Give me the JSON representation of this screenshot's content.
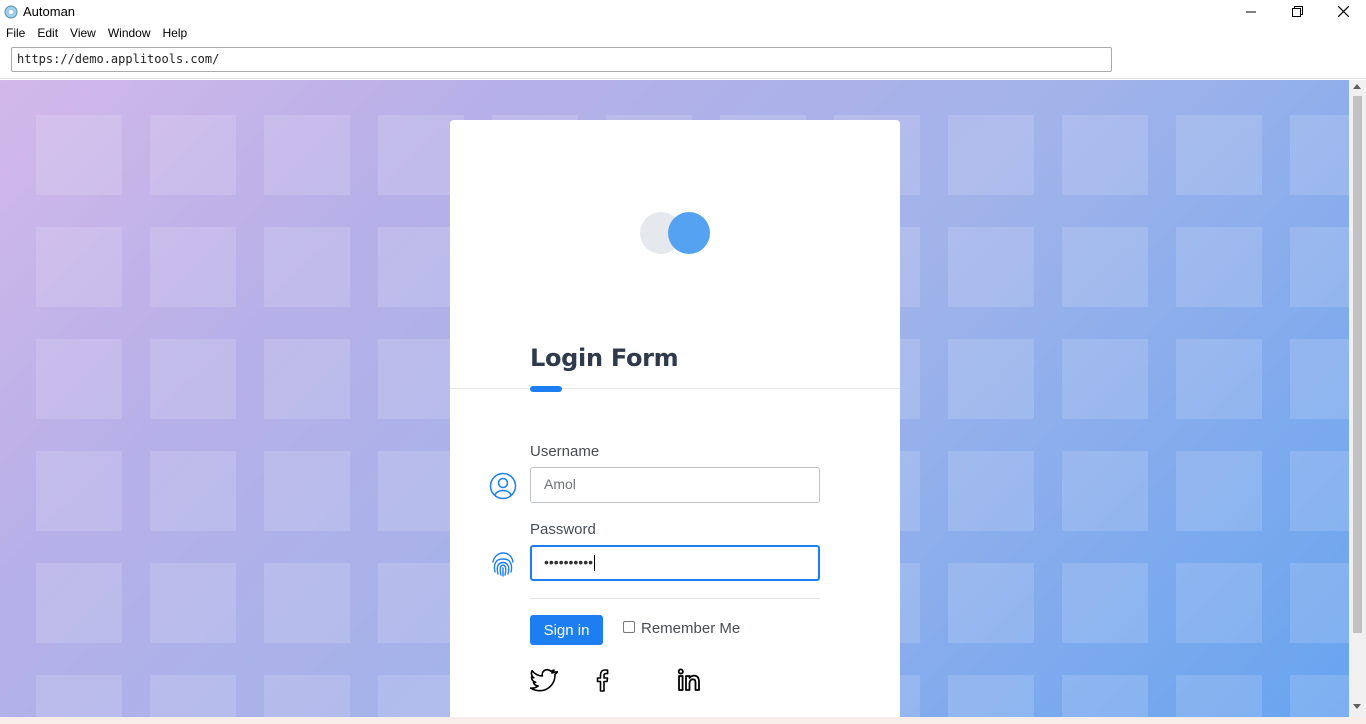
{
  "window": {
    "title": "Automan",
    "controls": {
      "minimize": "minimize-icon",
      "maximize": "restore-icon",
      "close": "close-icon"
    }
  },
  "menu": [
    "File",
    "Edit",
    "View",
    "Window",
    "Help"
  ],
  "address_bar": {
    "url": "https://demo.applitools.com/"
  },
  "login": {
    "title": "Login Form",
    "username_label": "Username",
    "username_placeholder": "Amol",
    "password_label": "Password",
    "password_value": "••••••••••",
    "signin_label": "Sign in",
    "remember_label": "Remember Me",
    "remember_checked": false
  },
  "social_icons": [
    "twitter-icon",
    "facebook-icon",
    "linkedin-icon"
  ],
  "colors": {
    "accent": "#1c7ef0",
    "title_text": "#2f3a4c",
    "logo_light": "#e5e9ee",
    "logo_blue": "#55a2f1"
  }
}
